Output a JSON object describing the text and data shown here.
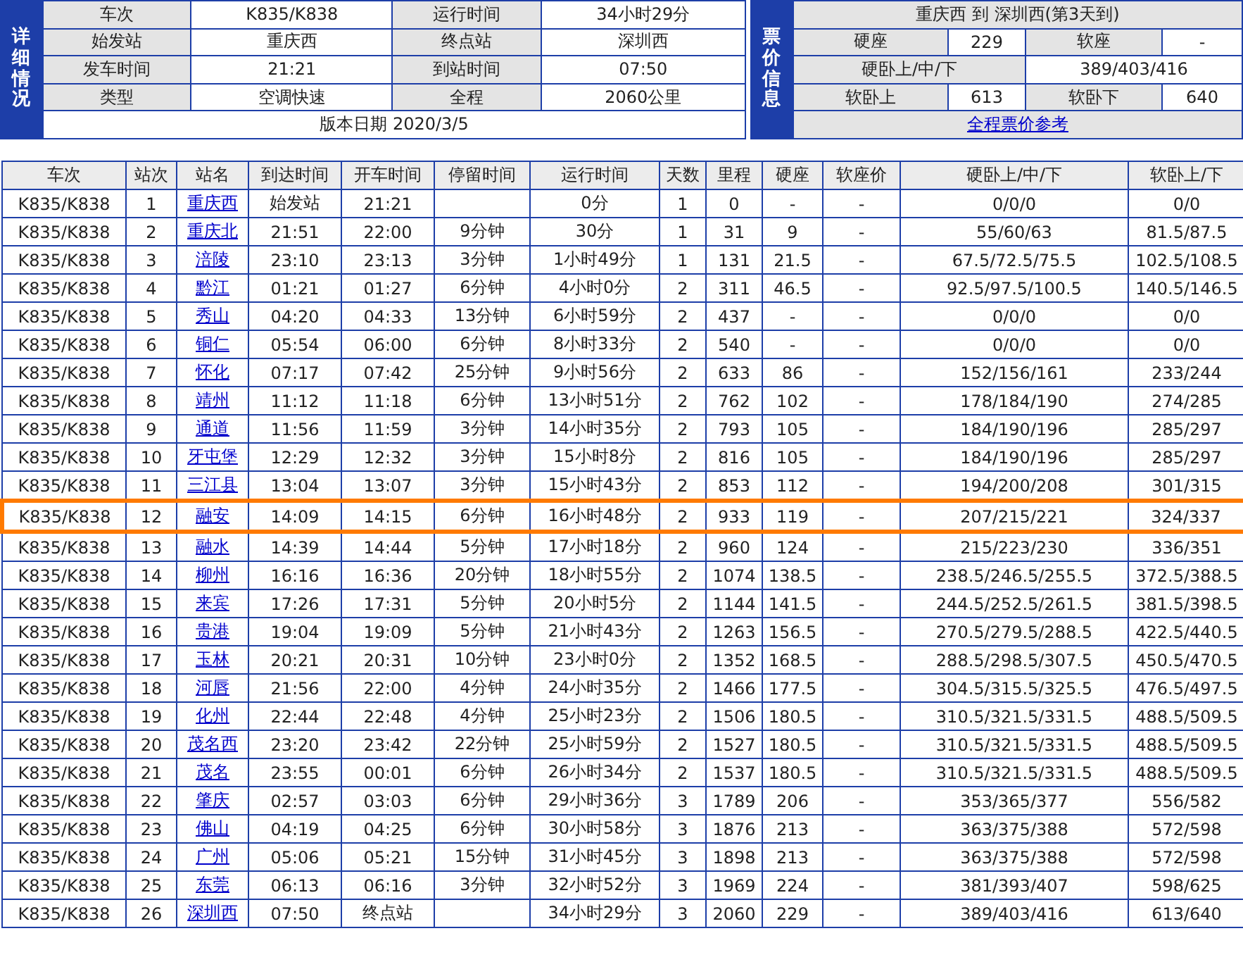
{
  "details": {
    "side_label": "详细情况",
    "fields": [
      {
        "label": "车次",
        "value": "K835/K838"
      },
      {
        "label": "运行时间",
        "value": "34小时29分"
      },
      {
        "label": "始发站",
        "value": "重庆西"
      },
      {
        "label": "终点站",
        "value": "深圳西"
      },
      {
        "label": "发车时间",
        "value": "21:21"
      },
      {
        "label": "到站时间",
        "value": "07:50"
      },
      {
        "label": "类型",
        "value": "空调快速"
      },
      {
        "label": "全程",
        "value": "2060公里"
      }
    ],
    "version": "版本日期 2020/3/5"
  },
  "fares": {
    "side_label": "票价信息",
    "route": "重庆西 到 深圳西(第3天到)",
    "items": [
      {
        "label": "硬座",
        "value": "229"
      },
      {
        "label": "软座",
        "value": "-"
      },
      {
        "label": "硬卧上/中/下",
        "value": "389/403/416"
      },
      {
        "label": "软卧上",
        "value": "613"
      },
      {
        "label": "软卧下",
        "value": "640"
      }
    ],
    "link": "全程票价参考"
  },
  "timetable": {
    "columns": [
      "车次",
      "站次",
      "站名",
      "到达时间",
      "开车时间",
      "停留时间",
      "运行时间",
      "天数",
      "里程",
      "硬座",
      "软座价",
      "硬卧上/中/下",
      "软卧上/下"
    ],
    "rows": [
      {
        "train": "K835/K838",
        "no": "1",
        "station": "重庆西",
        "arrive": "始发站",
        "depart": "21:21",
        "elapsed": "0分",
        "day": "1",
        "km": "0",
        "hard_seat": "-",
        "soft_seat": "-",
        "hard_sleeper": "0/0/0",
        "soft_sleeper": "0/0",
        "highlighted": false
      },
      {
        "train": "K835/K838",
        "no": "2",
        "station": "重庆北",
        "arrive": "21:51",
        "depart": "22:00",
        "stop": "9分钟",
        "elapsed": "30分",
        "day": "1",
        "km": "31",
        "hard_seat": "9",
        "soft_seat": "-",
        "hard_sleeper": "55/60/63",
        "soft_sleeper": "81.5/87.5",
        "highlighted": false
      },
      {
        "train": "K835/K838",
        "no": "3",
        "station": "涪陵",
        "arrive": "23:10",
        "depart": "23:13",
        "stop": "3分钟",
        "elapsed": "1小时49分",
        "day": "1",
        "km": "131",
        "hard_seat": "21.5",
        "soft_seat": "-",
        "hard_sleeper": "67.5/72.5/75.5",
        "soft_sleeper": "102.5/108.5",
        "highlighted": false
      },
      {
        "train": "K835/K838",
        "no": "4",
        "station": "黔江",
        "arrive": "01:21",
        "depart": "01:27",
        "stop": "6分钟",
        "elapsed": "4小时0分",
        "day": "2",
        "km": "311",
        "hard_seat": "46.5",
        "soft_seat": "-",
        "hard_sleeper": "92.5/97.5/100.5",
        "soft_sleeper": "140.5/146.5",
        "highlighted": false
      },
      {
        "train": "K835/K838",
        "no": "5",
        "station": "秀山",
        "arrive": "04:20",
        "depart": "04:33",
        "stop": "13分钟",
        "elapsed": "6小时59分",
        "day": "2",
        "km": "437",
        "hard_seat": "-",
        "soft_seat": "-",
        "hard_sleeper": "0/0/0",
        "soft_sleeper": "0/0",
        "highlighted": false
      },
      {
        "train": "K835/K838",
        "no": "6",
        "station": "铜仁",
        "arrive": "05:54",
        "depart": "06:00",
        "stop": "6分钟",
        "elapsed": "8小时33分",
        "day": "2",
        "km": "540",
        "hard_seat": "-",
        "soft_seat": "-",
        "hard_sleeper": "0/0/0",
        "soft_sleeper": "0/0",
        "highlighted": false
      },
      {
        "train": "K835/K838",
        "no": "7",
        "station": "怀化",
        "arrive": "07:17",
        "depart": "07:42",
        "stop": "25分钟",
        "elapsed": "9小时56分",
        "day": "2",
        "km": "633",
        "hard_seat": "86",
        "soft_seat": "-",
        "hard_sleeper": "152/156/161",
        "soft_sleeper": "233/244",
        "highlighted": false
      },
      {
        "train": "K835/K838",
        "no": "8",
        "station": "靖州",
        "arrive": "11:12",
        "depart": "11:18",
        "stop": "6分钟",
        "elapsed": "13小时51分",
        "day": "2",
        "km": "762",
        "hard_seat": "102",
        "soft_seat": "-",
        "hard_sleeper": "178/184/190",
        "soft_sleeper": "274/285",
        "highlighted": false
      },
      {
        "train": "K835/K838",
        "no": "9",
        "station": "通道",
        "arrive": "11:56",
        "depart": "11:59",
        "stop": "3分钟",
        "elapsed": "14小时35分",
        "day": "2",
        "km": "793",
        "hard_seat": "105",
        "soft_seat": "-",
        "hard_sleeper": "184/190/196",
        "soft_sleeper": "285/297",
        "highlighted": false
      },
      {
        "train": "K835/K838",
        "no": "10",
        "station": "牙屯堡",
        "arrive": "12:29",
        "depart": "12:32",
        "stop": "3分钟",
        "elapsed": "15小时8分",
        "day": "2",
        "km": "816",
        "hard_seat": "105",
        "soft_seat": "-",
        "hard_sleeper": "184/190/196",
        "soft_sleeper": "285/297",
        "highlighted": false
      },
      {
        "train": "K835/K838",
        "no": "11",
        "station": "三江县",
        "arrive": "13:04",
        "depart": "13:07",
        "stop": "3分钟",
        "elapsed": "15小时43分",
        "day": "2",
        "km": "853",
        "hard_seat": "112",
        "soft_seat": "-",
        "hard_sleeper": "194/200/208",
        "soft_sleeper": "301/315",
        "highlighted": false
      },
      {
        "train": "K835/K838",
        "no": "12",
        "station": "融安",
        "arrive": "14:09",
        "depart": "14:15",
        "stop": "6分钟",
        "elapsed": "16小时48分",
        "day": "2",
        "km": "933",
        "hard_seat": "119",
        "soft_seat": "-",
        "hard_sleeper": "207/215/221",
        "soft_sleeper": "324/337",
        "highlighted": true
      },
      {
        "train": "K835/K838",
        "no": "13",
        "station": "融水",
        "arrive": "14:39",
        "depart": "14:44",
        "stop": "5分钟",
        "elapsed": "17小时18分",
        "day": "2",
        "km": "960",
        "hard_seat": "124",
        "soft_seat": "-",
        "hard_sleeper": "215/223/230",
        "soft_sleeper": "336/351",
        "highlighted": false
      },
      {
        "train": "K835/K838",
        "no": "14",
        "station": "柳州",
        "arrive": "16:16",
        "depart": "16:36",
        "stop": "20分钟",
        "elapsed": "18小时55分",
        "day": "2",
        "km": "1074",
        "hard_seat": "138.5",
        "soft_seat": "-",
        "hard_sleeper": "238.5/246.5/255.5",
        "soft_sleeper": "372.5/388.5",
        "highlighted": false
      },
      {
        "train": "K835/K838",
        "no": "15",
        "station": "来宾",
        "arrive": "17:26",
        "depart": "17:31",
        "stop": "5分钟",
        "elapsed": "20小时5分",
        "day": "2",
        "km": "1144",
        "hard_seat": "141.5",
        "soft_seat": "-",
        "hard_sleeper": "244.5/252.5/261.5",
        "soft_sleeper": "381.5/398.5",
        "highlighted": false
      },
      {
        "train": "K835/K838",
        "no": "16",
        "station": "贵港",
        "arrive": "19:04",
        "depart": "19:09",
        "stop": "5分钟",
        "elapsed": "21小时43分",
        "day": "2",
        "km": "1263",
        "hard_seat": "156.5",
        "soft_seat": "-",
        "hard_sleeper": "270.5/279.5/288.5",
        "soft_sleeper": "422.5/440.5",
        "highlighted": false
      },
      {
        "train": "K835/K838",
        "no": "17",
        "station": "玉林",
        "arrive": "20:21",
        "depart": "20:31",
        "stop": "10分钟",
        "elapsed": "23小时0分",
        "day": "2",
        "km": "1352",
        "hard_seat": "168.5",
        "soft_seat": "-",
        "hard_sleeper": "288.5/298.5/307.5",
        "soft_sleeper": "450.5/470.5",
        "highlighted": false
      },
      {
        "train": "K835/K838",
        "no": "18",
        "station": "河唇",
        "arrive": "21:56",
        "depart": "22:00",
        "stop": "4分钟",
        "elapsed": "24小时35分",
        "day": "2",
        "km": "1466",
        "hard_seat": "177.5",
        "soft_seat": "-",
        "hard_sleeper": "304.5/315.5/325.5",
        "soft_sleeper": "476.5/497.5",
        "highlighted": false
      },
      {
        "train": "K835/K838",
        "no": "19",
        "station": "化州",
        "arrive": "22:44",
        "depart": "22:48",
        "stop": "4分钟",
        "elapsed": "25小时23分",
        "day": "2",
        "km": "1506",
        "hard_seat": "180.5",
        "soft_seat": "-",
        "hard_sleeper": "310.5/321.5/331.5",
        "soft_sleeper": "488.5/509.5",
        "highlighted": false
      },
      {
        "train": "K835/K838",
        "no": "20",
        "station": "茂名西",
        "arrive": "23:20",
        "depart": "23:42",
        "stop": "22分钟",
        "elapsed": "25小时59分",
        "day": "2",
        "km": "1527",
        "hard_seat": "180.5",
        "soft_seat": "-",
        "hard_sleeper": "310.5/321.5/331.5",
        "soft_sleeper": "488.5/509.5",
        "highlighted": false
      },
      {
        "train": "K835/K838",
        "no": "21",
        "station": "茂名",
        "arrive": "23:55",
        "depart": "00:01",
        "stop": "6分钟",
        "elapsed": "26小时34分",
        "day": "2",
        "km": "1537",
        "hard_seat": "180.5",
        "soft_seat": "-",
        "hard_sleeper": "310.5/321.5/331.5",
        "soft_sleeper": "488.5/509.5",
        "highlighted": false
      },
      {
        "train": "K835/K838",
        "no": "22",
        "station": "肇庆",
        "arrive": "02:57",
        "depart": "03:03",
        "stop": "6分钟",
        "elapsed": "29小时36分",
        "day": "3",
        "km": "1789",
        "hard_seat": "206",
        "soft_seat": "-",
        "hard_sleeper": "353/365/377",
        "soft_sleeper": "556/582",
        "highlighted": false
      },
      {
        "train": "K835/K838",
        "no": "23",
        "station": "佛山",
        "arrive": "04:19",
        "depart": "04:25",
        "stop": "6分钟",
        "elapsed": "30小时58分",
        "day": "3",
        "km": "1876",
        "hard_seat": "213",
        "soft_seat": "-",
        "hard_sleeper": "363/375/388",
        "soft_sleeper": "572/598",
        "highlighted": false
      },
      {
        "train": "K835/K838",
        "no": "24",
        "station": "广州",
        "arrive": "05:06",
        "depart": "05:21",
        "stop": "15分钟",
        "elapsed": "31小时45分",
        "day": "3",
        "km": "1898",
        "hard_seat": "213",
        "soft_seat": "-",
        "hard_sleeper": "363/375/388",
        "soft_sleeper": "572/598",
        "highlighted": false
      },
      {
        "train": "K835/K838",
        "no": "25",
        "station": "东莞",
        "arrive": "06:13",
        "depart": "06:16",
        "stop": "3分钟",
        "elapsed": "32小时52分",
        "day": "3",
        "km": "1969",
        "hard_seat": "224",
        "soft_seat": "-",
        "hard_sleeper": "381/393/407",
        "soft_sleeper": "598/625",
        "highlighted": false
      },
      {
        "train": "K835/K838",
        "no": "26",
        "station": "深圳西",
        "arrive": "07:50",
        "depart": "终点站",
        "elapsed": "34小时29分",
        "day": "3",
        "km": "2060",
        "hard_seat": "229",
        "soft_seat": "-",
        "hard_sleeper": "389/403/416",
        "soft_sleeper": "613/640",
        "highlighted": false
      }
    ]
  }
}
